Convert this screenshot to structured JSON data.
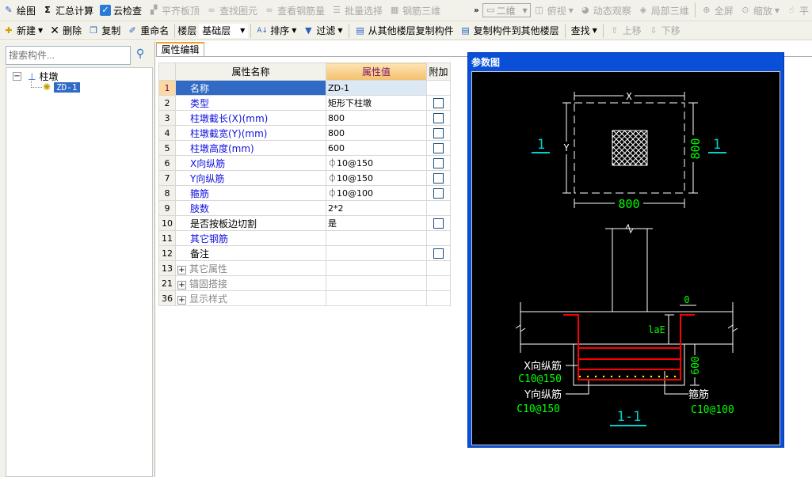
{
  "toolbar1": [
    {
      "label": "绘图",
      "icon": "draw-icon",
      "enabled": true
    },
    {
      "label": "汇总计算",
      "icon": "sigma-icon",
      "enabled": true
    },
    {
      "label": "云检查",
      "icon": "cloud-check-icon",
      "enabled": true
    },
    {
      "label": "平齐板顶",
      "icon": "align-slab-icon",
      "enabled": false
    },
    {
      "label": "查找图元",
      "icon": "binoculars-icon",
      "enabled": false
    },
    {
      "label": "查看钢筋量",
      "icon": "glasses-icon",
      "enabled": false
    },
    {
      "label": "批量选择",
      "icon": "batch-select-icon",
      "enabled": false
    },
    {
      "label": "钢筋三维",
      "icon": "rebar-3d-icon",
      "enabled": false
    }
  ],
  "toolbar1_overflow": "»",
  "view_combo": "二维",
  "toolbar1b": [
    {
      "label": "俯视",
      "icon": "cube-icon"
    },
    {
      "label": "动态观察",
      "icon": "orbit-icon"
    },
    {
      "label": "局部三维",
      "icon": "local-3d-icon"
    },
    {
      "label": "全屏",
      "icon": "zoom-full-icon"
    },
    {
      "label": "缩放",
      "icon": "zoom-icon"
    },
    {
      "label": "平",
      "icon": "pan-icon"
    }
  ],
  "toolbar2": {
    "new": "新建",
    "delete": "删除",
    "copy": "复制",
    "rename": "重命名",
    "floor_label": "楼层",
    "floor_value": "基础层",
    "sort": "排序",
    "filter": "过滤",
    "copy_from": "从其他楼层复制构件",
    "copy_to": "复制构件到其他楼层",
    "find": "查找",
    "move_up": "上移",
    "move_down": "下移"
  },
  "left": {
    "search_placeholder": "搜索构件...",
    "tree": {
      "root": "柱墩",
      "child": "ZD-1"
    }
  },
  "tab": "属性编辑",
  "grid": {
    "headers": {
      "name": "属性名称",
      "value": "属性值",
      "attach": "附加"
    },
    "rows": [
      {
        "n": "1",
        "name": "名称",
        "value": "ZD-1",
        "blue": true,
        "cb": false
      },
      {
        "n": "2",
        "name": "类型",
        "value": "矩形下柱墩",
        "blue": true,
        "cb": true
      },
      {
        "n": "3",
        "name": "柱墩截长(X)(mm)",
        "value": "800",
        "blue": true,
        "cb": true
      },
      {
        "n": "4",
        "name": "柱墩截宽(Y)(mm)",
        "value": "800",
        "blue": true,
        "cb": true
      },
      {
        "n": "5",
        "name": "柱墩高度(mm)",
        "value": "600",
        "blue": true,
        "cb": true
      },
      {
        "n": "6",
        "name": "X向纵筋",
        "value": "⏀10@150",
        "blue": true,
        "cb": true
      },
      {
        "n": "7",
        "name": "Y向纵筋",
        "value": "⏀10@150",
        "blue": true,
        "cb": true
      },
      {
        "n": "8",
        "name": "箍筋",
        "value": "⏀10@100",
        "blue": true,
        "cb": true
      },
      {
        "n": "9",
        "name": "肢数",
        "value": "2*2",
        "blue": true,
        "cb": false
      },
      {
        "n": "10",
        "name": "是否按板边切割",
        "value": "是",
        "blue": false,
        "cb": true
      },
      {
        "n": "11",
        "name": "其它钢筋",
        "value": "",
        "blue": true,
        "cb": false
      },
      {
        "n": "12",
        "name": "备注",
        "value": "",
        "blue": false,
        "cb": true
      }
    ],
    "groups": [
      {
        "n": "13",
        "name": "其它属性"
      },
      {
        "n": "21",
        "name": "锚固搭接"
      },
      {
        "n": "36",
        "name": "显示样式"
      }
    ]
  },
  "diagram": {
    "title": "参数图",
    "x_label": "X",
    "y_label": "Y",
    "x_dim": "800",
    "y_dim": "800",
    "section_mark": "1",
    "cover": "0",
    "anchor": "laE",
    "height_dim": "600",
    "x_rebar": "X向纵筋",
    "x_rebar_spec": "C10@150",
    "y_rebar": "Y向纵筋",
    "y_rebar_spec": "C10@150",
    "stirrup": "箍筋",
    "stirrup_spec": "C10@100",
    "section_title": "1-1",
    "colors": {
      "dim": "#00ff00",
      "section": "#00d0d0",
      "rebar": "#ff0000",
      "line": "#ffffff",
      "dots": "#ffff00"
    }
  }
}
